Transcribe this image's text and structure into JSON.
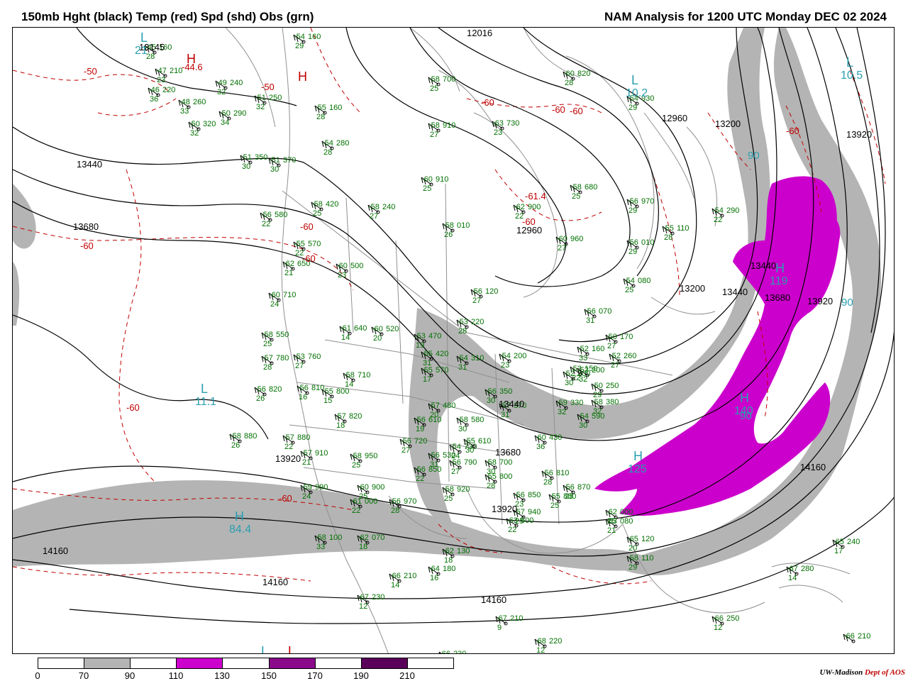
{
  "title_left": "150mb Hght (black) Temp (red) Spd (shd) Obs (grn)",
  "title_right": "NAM Analysis for 1200 UTC Monday  DEC 02 2024",
  "credit": {
    "org": "UW-Madison",
    "dept": "Dept of AOS"
  },
  "colors": {
    "height_contour": "#000000",
    "temperature_contour": "#c00000",
    "observations": "#007000",
    "speed_label": "#2a9fb0",
    "borders": "#909090",
    "spd_70_90": "#b4b4b4",
    "spd_110_130": "#cc00cc",
    "spd_150_170": "#8a0a8a",
    "spd_190_210": "#5a005a"
  },
  "colorbar": {
    "segments": [
      "#ffffff",
      "#b4b4b4",
      "#ffffff",
      "#cc00cc",
      "#ffffff",
      "#8a0a8a",
      "#ffffff",
      "#5a005a",
      "#ffffff"
    ],
    "ticks": [
      "0",
      "70",
      "90",
      "110",
      "130",
      "150",
      "170",
      "190",
      "210"
    ]
  },
  "height_labels": [
    {
      "text": "13145"
    },
    {
      "text": "13440"
    },
    {
      "text": "13680"
    },
    {
      "text": "12960"
    },
    {
      "text": "12960"
    },
    {
      "text": "13200"
    },
    {
      "text": "13440"
    },
    {
      "text": "13920"
    },
    {
      "text": "13200"
    },
    {
      "text": "13440"
    },
    {
      "text": "13680"
    },
    {
      "text": "13920"
    },
    {
      "text": "13440"
    },
    {
      "text": "13680"
    },
    {
      "text": "13920"
    },
    {
      "text": "13920"
    },
    {
      "text": "14160"
    },
    {
      "text": "14160"
    },
    {
      "text": "14160"
    },
    {
      "text": "14160"
    },
    {
      "text": "12016"
    }
  ],
  "temp_labels": [
    {
      "text": "-50"
    },
    {
      "text": "-44.6"
    },
    {
      "text": "-60"
    },
    {
      "text": "-60"
    },
    {
      "text": "-60"
    },
    {
      "text": "-60"
    },
    {
      "text": "-60"
    },
    {
      "text": "-60"
    },
    {
      "text": "-61.4"
    },
    {
      "text": "-60"
    },
    {
      "text": "-60"
    },
    {
      "text": "-60"
    },
    {
      "text": "-50"
    },
    {
      "text": "-60"
    }
  ],
  "center_markers": [
    {
      "letter": "L",
      "value": "10.2",
      "kind": "speed"
    },
    {
      "letter": "L",
      "value": "10.5",
      "kind": "speed"
    },
    {
      "letter": "L",
      "value": "11.1",
      "kind": "speed"
    },
    {
      "letter": "H",
      "value": "84.4",
      "kind": "speed"
    },
    {
      "letter": "H",
      "value": "119",
      "kind": "speed"
    },
    {
      "letter": "H",
      "value": "140",
      "kind": "speed"
    },
    {
      "letter": "H",
      "value": "125",
      "kind": "speed"
    },
    {
      "letter": "L",
      "value": "21",
      "kind": "speed"
    },
    {
      "letter": "H",
      "value": "",
      "kind": "temp"
    },
    {
      "letter": "H",
      "value": "",
      "kind": "temp"
    },
    {
      "letter": "L",
      "value": "",
      "kind": "speed"
    },
    {
      "letter": "L",
      "value": "",
      "kind": "temp"
    }
  ],
  "speed_values": [
    {
      "text": "90"
    },
    {
      "text": "90"
    },
    {
      "text": "90"
    }
  ],
  "observations": [
    {
      "t": "-45",
      "h": "160",
      "d": "28"
    },
    {
      "t": "-47",
      "h": "210",
      "d": "23"
    },
    {
      "t": "-46",
      "h": "220",
      "d": "36"
    },
    {
      "t": "-49",
      "h": "240",
      "d": "32"
    },
    {
      "t": "-51",
      "h": "250",
      "d": "32"
    },
    {
      "t": "-48",
      "h": "260",
      "d": "33"
    },
    {
      "t": "-50",
      "h": "290",
      "d": "34"
    },
    {
      "t": "-50",
      "h": "320",
      "d": "32"
    },
    {
      "t": "-54",
      "h": "160",
      "d": "29"
    },
    {
      "t": "-55",
      "h": "160",
      "d": "28"
    },
    {
      "t": "-54",
      "h": "280",
      "d": "28"
    },
    {
      "t": "-51",
      "h": "350",
      "d": "30"
    },
    {
      "t": "-51",
      "h": "370",
      "d": "30"
    },
    {
      "t": "-58",
      "h": "420",
      "d": "25"
    },
    {
      "t": "-56",
      "h": "580",
      "d": "22"
    },
    {
      "t": "-58",
      "h": "240",
      "d": "27"
    },
    {
      "t": "-55",
      "h": "570",
      "d": "22"
    },
    {
      "t": "-62",
      "h": "650",
      "d": "21"
    },
    {
      "t": "-60",
      "h": "500",
      "d": "23"
    },
    {
      "t": "-60",
      "h": "710",
      "d": "24"
    },
    {
      "t": "-58",
      "h": "700",
      "d": "25"
    },
    {
      "t": "-60",
      "h": "910",
      "d": "25"
    },
    {
      "t": "-63",
      "h": "730",
      "d": "23"
    },
    {
      "t": "-58",
      "h": "910",
      "d": "27"
    },
    {
      "t": "-60",
      "h": "820",
      "d": "28"
    },
    {
      "t": "-54",
      "h": "930",
      "d": "29"
    },
    {
      "t": "-58",
      "h": "680",
      "d": "25"
    },
    {
      "t": "-56",
      "h": "970",
      "d": "29"
    },
    {
      "t": "-62",
      "h": "900",
      "d": "22"
    },
    {
      "t": "-58",
      "h": "010",
      "d": "26"
    },
    {
      "t": "-60",
      "h": "960",
      "d": "27"
    },
    {
      "t": "-56",
      "h": "010",
      "d": "29"
    },
    {
      "t": "-55",
      "h": "110",
      "d": "28"
    },
    {
      "t": "-54",
      "h": "290",
      "d": "22"
    },
    {
      "t": "-54",
      "h": "080",
      "d": "25"
    },
    {
      "t": "-56",
      "h": "120",
      "d": "27"
    },
    {
      "t": "-56",
      "h": "070",
      "d": "31"
    },
    {
      "t": "-53",
      "h": "220",
      "d": "28"
    },
    {
      "t": "-61",
      "h": "640",
      "d": "14"
    },
    {
      "t": "-60",
      "h": "520",
      "d": "20"
    },
    {
      "t": "-58",
      "h": "550",
      "d": "25"
    },
    {
      "t": "-57",
      "h": "780",
      "d": "28"
    },
    {
      "t": "-53",
      "h": "760",
      "d": "27"
    },
    {
      "t": "-58",
      "h": "710",
      "d": "14"
    },
    {
      "t": "-56",
      "h": "820",
      "d": "26"
    },
    {
      "t": "-56",
      "h": "810",
      "d": "16"
    },
    {
      "t": "-55",
      "h": "800",
      "d": "15"
    },
    {
      "t": "-57",
      "h": "820",
      "d": "18"
    },
    {
      "t": "-58",
      "h": "880",
      "d": "26"
    },
    {
      "t": "-57",
      "h": "880",
      "d": "22"
    },
    {
      "t": "-57",
      "h": "910",
      "d": "21"
    },
    {
      "t": "-58",
      "h": "950",
      "d": "25"
    },
    {
      "t": "-60",
      "h": "900",
      "d": "25"
    },
    {
      "t": "-59",
      "h": "990",
      "d": "24"
    },
    {
      "t": "-61",
      "h": "000",
      "d": "22"
    },
    {
      "t": "-56",
      "h": "970",
      "d": "28"
    },
    {
      "t": "-53",
      "h": "470",
      "d": "19"
    },
    {
      "t": "-55",
      "h": "420",
      "d": "31"
    },
    {
      "t": "-55",
      "h": "570",
      "d": "17"
    },
    {
      "t": "-54",
      "h": "310",
      "d": "31"
    },
    {
      "t": "-54",
      "h": "200",
      "d": "23"
    },
    {
      "t": "-53",
      "h": "150",
      "d": "22"
    },
    {
      "t": "-52",
      "h": "200",
      "d": "30"
    },
    {
      "t": "-50",
      "h": "170",
      "d": "27"
    },
    {
      "t": "-52",
      "h": "160",
      "d": "33"
    },
    {
      "t": "-52",
      "h": "260",
      "d": "27"
    },
    {
      "t": "-52",
      "h": "200",
      "d": "32"
    },
    {
      "t": "-50",
      "h": "250",
      "d": "29"
    },
    {
      "t": "-56",
      "h": "350",
      "d": "30"
    },
    {
      "t": "-57",
      "h": "370",
      "d": "31"
    },
    {
      "t": "-59",
      "h": "330",
      "d": "32"
    },
    {
      "t": "-58",
      "h": "380",
      "d": "32"
    },
    {
      "t": "-57",
      "h": "480",
      "d": "20"
    },
    {
      "t": "-56",
      "h": "610",
      "d": "19"
    },
    {
      "t": "-58",
      "h": "580",
      "d": "30"
    },
    {
      "t": "-56",
      "h": "720",
      "d": "27"
    },
    {
      "t": "-54",
      "h": "730",
      "d": "24"
    },
    {
      "t": "-55",
      "h": "610",
      "d": "30"
    },
    {
      "t": "-56",
      "h": "530",
      "d": "31"
    },
    {
      "t": "-60",
      "h": "430",
      "d": "36"
    },
    {
      "t": "-54",
      "h": "590",
      "d": "30"
    },
    {
      "t": "-56",
      "h": "790",
      "d": "27"
    },
    {
      "t": "-56",
      "h": "850",
      "d": "22"
    },
    {
      "t": "-58",
      "h": "700",
      "d": "30"
    },
    {
      "t": "-55",
      "h": "800",
      "d": "28"
    },
    {
      "t": "-56",
      "h": "810",
      "d": "28"
    },
    {
      "t": "-56",
      "h": "850",
      "d": "23"
    },
    {
      "t": "-55",
      "h": "880",
      "d": "25"
    },
    {
      "t": "-56",
      "h": "870",
      "d": "23"
    },
    {
      "t": "-58",
      "h": "920",
      "d": "25"
    },
    {
      "t": "-57",
      "h": "940",
      "d": "25"
    },
    {
      "t": "-63",
      "h": "500",
      "d": "22"
    },
    {
      "t": "-62",
      "h": "000",
      "d": "25"
    },
    {
      "t": "-63",
      "h": "080",
      "d": "21"
    },
    {
      "t": "-65",
      "h": "120",
      "d": "20"
    },
    {
      "t": "-58",
      "h": "110",
      "d": "29"
    },
    {
      "t": "-58",
      "h": "100",
      "d": "33"
    },
    {
      "t": "-62",
      "h": "070",
      "d": "18"
    },
    {
      "t": "-62",
      "h": "130",
      "d": "18"
    },
    {
      "t": "-64",
      "h": "180",
      "d": "16"
    },
    {
      "t": "-66",
      "h": "210",
      "d": "14"
    },
    {
      "t": "-67",
      "h": "230",
      "d": "12"
    },
    {
      "t": "-67",
      "h": "210",
      "d": "9"
    },
    {
      "t": "-68",
      "h": "220",
      "d": "12"
    },
    {
      "t": "-66",
      "h": "250",
      "d": "12"
    },
    {
      "t": "-65",
      "h": "240",
      "d": "17"
    },
    {
      "t": "-67",
      "h": "280",
      "d": "14"
    },
    {
      "t": "-66",
      "h": "210",
      "d": ""
    },
    {
      "t": "-65",
      "h": "220",
      "d": ""
    },
    {
      "t": "-66",
      "h": "230",
      "d": ""
    }
  ]
}
